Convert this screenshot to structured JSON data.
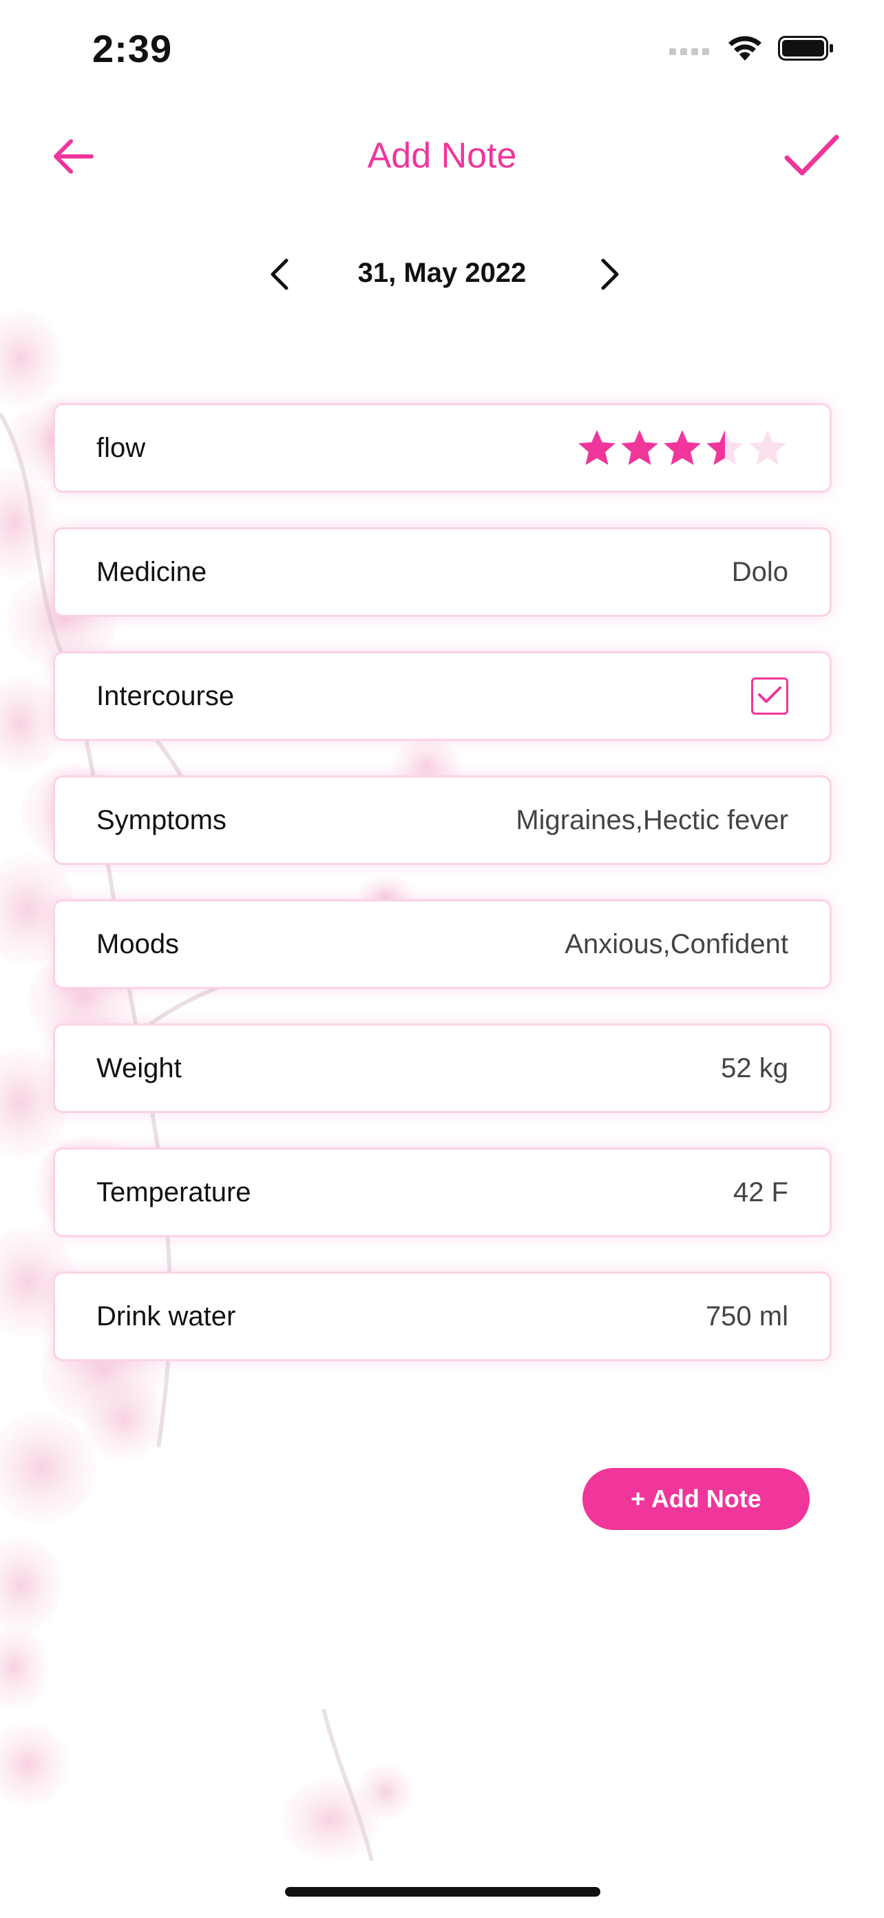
{
  "status_bar": {
    "time": "2:39",
    "icons": [
      "signal-icon",
      "wifi-icon",
      "battery-icon"
    ]
  },
  "header": {
    "title": "Add Note",
    "back_icon": "arrow-left-icon",
    "confirm_icon": "checkmark-icon"
  },
  "date_nav": {
    "date": "31, May 2022",
    "prev_icon": "chevron-left-icon",
    "next_icon": "chevron-right-icon"
  },
  "entries": {
    "flow": {
      "label": "flow",
      "rating": 3.5,
      "max_rating": 5
    },
    "medicine": {
      "label": "Medicine",
      "value": "Dolo"
    },
    "intercourse": {
      "label": "Intercourse",
      "checked": true
    },
    "symptoms": {
      "label": "Symptoms",
      "value": "Migraines,Hectic fever"
    },
    "moods": {
      "label": "Moods",
      "value": "Anxious,Confident"
    },
    "weight": {
      "label": "Weight",
      "value": "52 kg"
    },
    "temperature": {
      "label": "Temperature",
      "value": "42 F"
    },
    "water": {
      "label": "Drink water",
      "value": "750 ml"
    }
  },
  "add_note_button": {
    "label": "+ Add Note"
  },
  "colors": {
    "accent": "#f0359b",
    "card_border": "#fbd2e6",
    "star_empty": "#fde0ee"
  }
}
